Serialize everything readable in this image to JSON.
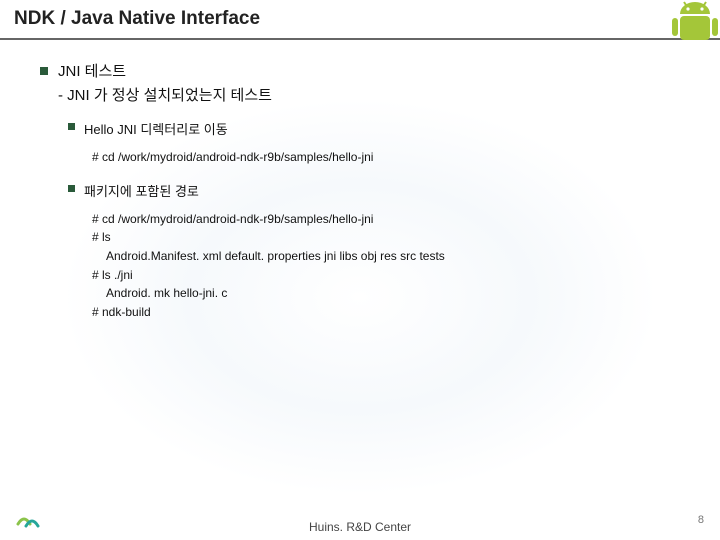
{
  "header": {
    "title": "NDK / Java Native Interface"
  },
  "content": {
    "b1_line1": "JNI 테스트",
    "b1_line2": "- JNI 가 정상 설치되었는지 테스트",
    "b2a": "Hello JNI 디렉터리로 이동",
    "code1_l1": "# cd /work/mydroid/android-ndk-r9b/samples/hello-jni",
    "b2b": "패키지에 포함된 경로",
    "code2_l1": "# cd /work/mydroid/android-ndk-r9b/samples/hello-jni",
    "code2_l2": "# ls",
    "code2_l3": "Android.Manifest. xml  default. properties  jni   libs  obj   res   src   tests",
    "code2_l4": "# ls  ./jni",
    "code2_l5": "Android. mk hello-jni. c",
    "code2_l6": "# ndk-build"
  },
  "footer": {
    "center": "Huins. R&D Center",
    "page": "8"
  }
}
